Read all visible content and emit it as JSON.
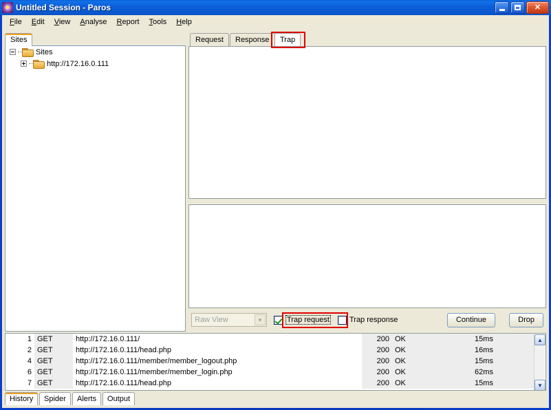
{
  "window": {
    "title": "Untitled Session - Paros",
    "icon": "paros-flower-icon",
    "minimize_label": "_",
    "maximize_label": "□",
    "close_label": "✕"
  },
  "menubar": {
    "items": [
      {
        "label": "File",
        "mnemonic": "F"
      },
      {
        "label": "Edit",
        "mnemonic": "E"
      },
      {
        "label": "View",
        "mnemonic": "V"
      },
      {
        "label": "Analyse",
        "mnemonic": "A"
      },
      {
        "label": "Report",
        "mnemonic": "R"
      },
      {
        "label": "Tools",
        "mnemonic": "T"
      },
      {
        "label": "Help",
        "mnemonic": "H"
      }
    ]
  },
  "left_panel": {
    "tab_label": "Sites",
    "tree": {
      "root": {
        "label": "Sites",
        "expander": "minus"
      },
      "child": {
        "label": "http://172.16.0.111",
        "expander": "plus"
      }
    }
  },
  "right_panel": {
    "tabs": [
      {
        "label": "Request",
        "active": false
      },
      {
        "label": "Response",
        "active": false
      },
      {
        "label": "Trap",
        "active": true,
        "highlighted": true
      }
    ],
    "top_pane_content": "",
    "bottom_pane_content": "",
    "controls": {
      "view_selector": {
        "value": "Raw View",
        "disabled": true,
        "arrow": "chevron-down-icon"
      },
      "trap_request": {
        "label": "Trap request",
        "checked": true,
        "highlighted": true
      },
      "trap_response": {
        "label": "Trap response",
        "checked": false,
        "highlighted": false
      },
      "continue_button": "Continue",
      "drop_button": "Drop"
    }
  },
  "history": {
    "columns": [
      "id",
      "method",
      "url",
      "code",
      "reason",
      "time"
    ],
    "rows": [
      {
        "id": "1",
        "method": "GET",
        "url": "http://172.16.0.111/",
        "code": "200",
        "reason": "OK",
        "time": "15ms"
      },
      {
        "id": "2",
        "method": "GET",
        "url": "http://172.16.0.111/head.php",
        "code": "200",
        "reason": "OK",
        "time": "16ms"
      },
      {
        "id": "4",
        "method": "GET",
        "url": "http://172.16.0.111/member/member_logout.php",
        "code": "200",
        "reason": "OK",
        "time": "15ms"
      },
      {
        "id": "6",
        "method": "GET",
        "url": "http://172.16.0.111/member/member_login.php",
        "code": "200",
        "reason": "OK",
        "time": "62ms"
      },
      {
        "id": "7",
        "method": "GET",
        "url": "http://172.16.0.111/head.php",
        "code": "200",
        "reason": "OK",
        "time": "15ms"
      }
    ],
    "scrollbar": {
      "up": "▲",
      "down": "▼"
    }
  },
  "bottom_tabs": [
    {
      "label": "History",
      "active": true
    },
    {
      "label": "Spider",
      "active": false
    },
    {
      "label": "Alerts",
      "active": false
    },
    {
      "label": "Output",
      "active": false
    }
  ],
  "colors": {
    "titlebar_blue": "#0A57CE",
    "face": "#ECE9D8",
    "annotation_red": "#E00000",
    "active_tab_orange": "#F0A020",
    "check_green": "#1A9B1A"
  }
}
